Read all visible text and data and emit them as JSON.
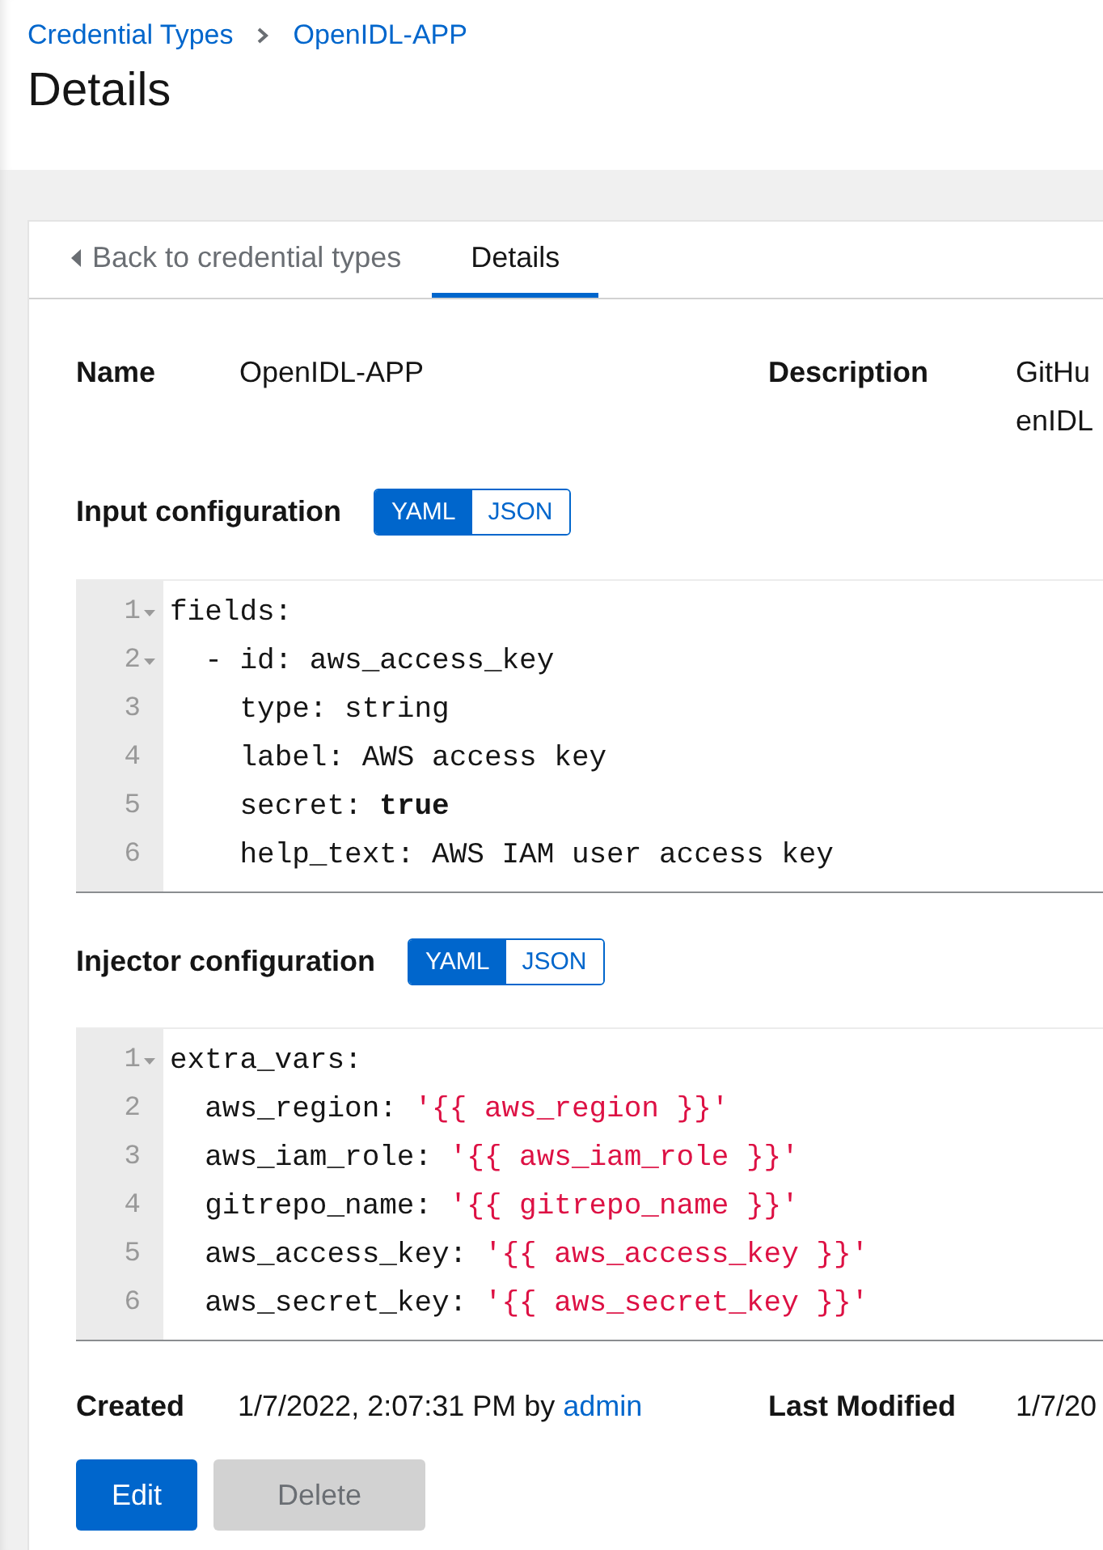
{
  "breadcrumb": [
    {
      "label": "Credential Types"
    },
    {
      "label": "OpenIDL-APP"
    }
  ],
  "page_title": "Details",
  "tabs": [
    {
      "label": "Back to credential types",
      "kind": "back",
      "selected": false
    },
    {
      "label": "Details",
      "kind": "tab",
      "selected": true
    }
  ],
  "details": [
    {
      "label": "Name",
      "value_lines": [
        "OpenIDL-APP"
      ]
    },
    {
      "label": "Description",
      "value_lines": [
        "GitHu",
        "enIDL"
      ]
    }
  ],
  "input_configuration": {
    "heading": "Input configuration",
    "formats": [
      {
        "label": "YAML",
        "selected": true
      },
      {
        "label": "JSON",
        "selected": false
      }
    ],
    "lines": [
      {
        "number": "1",
        "foldable": true,
        "tokens": [
          {
            "kind": "plain",
            "text": "fields:"
          }
        ]
      },
      {
        "number": "2",
        "foldable": true,
        "tokens": [
          {
            "kind": "plain",
            "text": "  - id: aws_access_key"
          }
        ]
      },
      {
        "number": "3",
        "foldable": false,
        "tokens": [
          {
            "kind": "plain",
            "text": "    type: string"
          }
        ]
      },
      {
        "number": "4",
        "foldable": false,
        "tokens": [
          {
            "kind": "plain",
            "text": "    label: AWS access key"
          }
        ]
      },
      {
        "number": "5",
        "foldable": false,
        "tokens": [
          {
            "kind": "plain",
            "text": "    secret: "
          },
          {
            "kind": "bool",
            "text": "true"
          }
        ]
      },
      {
        "number": "6",
        "foldable": false,
        "tokens": [
          {
            "kind": "plain",
            "text": "    help_text: AWS IAM user access key"
          }
        ]
      }
    ]
  },
  "injector_configuration": {
    "heading": "Injector configuration",
    "formats": [
      {
        "label": "YAML",
        "selected": true
      },
      {
        "label": "JSON",
        "selected": false
      }
    ],
    "lines": [
      {
        "number": "1",
        "foldable": true,
        "tokens": [
          {
            "kind": "plain",
            "text": "extra_vars:"
          }
        ]
      },
      {
        "number": "2",
        "foldable": false,
        "tokens": [
          {
            "kind": "plain",
            "text": "  aws_region: "
          },
          {
            "kind": "string",
            "text": "'{{ aws_region }}'"
          }
        ]
      },
      {
        "number": "3",
        "foldable": false,
        "tokens": [
          {
            "kind": "plain",
            "text": "  aws_iam_role: "
          },
          {
            "kind": "string",
            "text": "'{{ aws_iam_role }}'"
          }
        ]
      },
      {
        "number": "4",
        "foldable": false,
        "tokens": [
          {
            "kind": "plain",
            "text": "  gitrepo_name: "
          },
          {
            "kind": "string",
            "text": "'{{ gitrepo_name }}'"
          }
        ]
      },
      {
        "number": "5",
        "foldable": false,
        "tokens": [
          {
            "kind": "plain",
            "text": "  aws_access_key: "
          },
          {
            "kind": "string",
            "text": "'{{ aws_access_key }}'"
          }
        ]
      },
      {
        "number": "6",
        "foldable": false,
        "tokens": [
          {
            "kind": "plain",
            "text": "  aws_secret_key: "
          },
          {
            "kind": "string",
            "text": "'{{ aws_secret_key }}'"
          }
        ]
      }
    ]
  },
  "created": {
    "label": "Created",
    "text": "1/7/2022, 2:07:31 PM by",
    "user": "admin"
  },
  "last_modified": {
    "label": "Last Modified",
    "text": "1/7/20"
  },
  "buttons": [
    {
      "label": "Edit",
      "kind": "primary",
      "disabled": false
    },
    {
      "label": "Delete",
      "kind": "danger",
      "disabled": true
    }
  ]
}
